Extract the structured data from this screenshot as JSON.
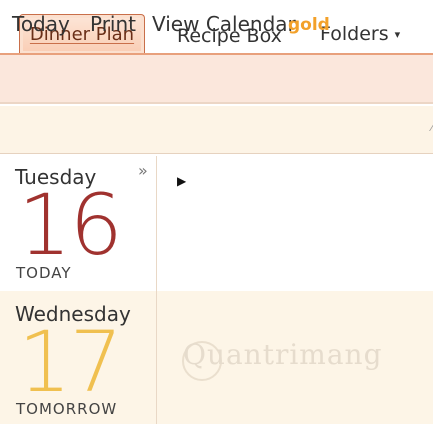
{
  "tabs": {
    "dinner_plan": "Dinner Plan",
    "recipe_box": "Recipe Box",
    "folders": "Folders",
    "folders_caret": "▾"
  },
  "subnav": {
    "today": "Today",
    "print": "Print",
    "view_calendar": "View Calendar",
    "gold": "gold"
  },
  "days": [
    {
      "name": "Tuesday",
      "number": "16",
      "label": "TODAY"
    },
    {
      "name": "Wednesday",
      "number": "17",
      "label": "TOMORROW"
    }
  ],
  "controls": {
    "expand_glyph": "»",
    "play_glyph": "▶"
  },
  "watermark": {
    "text": "Quantrimang"
  },
  "colors": {
    "accent": "#e8a07c",
    "today_number": "#a0322f",
    "tomorrow_number": "#f0c050",
    "gold": "#f3a12a"
  }
}
